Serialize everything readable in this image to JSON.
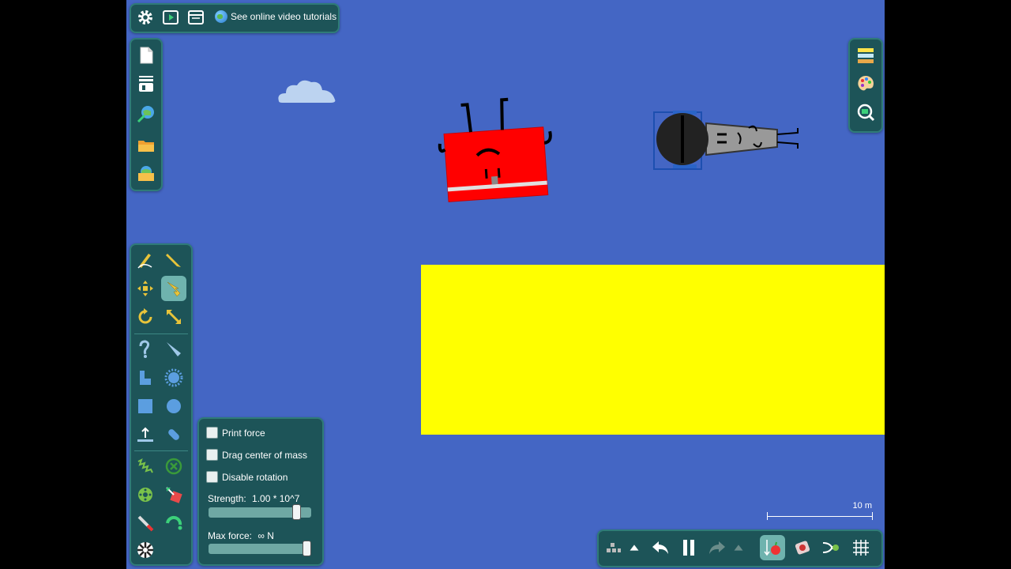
{
  "toolbar_top": {
    "tutorials_label": "See online video tutorials",
    "icons": [
      "gear-icon",
      "play-video-icon",
      "window-icon",
      "globe-icon"
    ]
  },
  "file_panel": {
    "icons": [
      "new-file-icon",
      "scene-settings-icon",
      "open-web-icon",
      "folder-icon",
      "save-icon"
    ]
  },
  "right_panel": {
    "icons": [
      "layers-icon",
      "palette-icon",
      "zoom-fit-icon"
    ]
  },
  "tools": {
    "icons": [
      "sketch-icon",
      "pencil-icon",
      "move-icon",
      "drag-hand-icon",
      "rotate-icon",
      "scale-icon",
      "chain-icon",
      "knife-icon",
      "polygon-icon",
      "gear-shape-icon",
      "box-icon",
      "circle-icon",
      "plane-icon",
      "thruster-icon",
      "spring-icon",
      "fixate-icon",
      "axle-icon",
      "hinge-icon",
      "laser-icon",
      "tracer-icon",
      "spiral-icon"
    ],
    "active": "drag-hand-icon"
  },
  "options": {
    "print_force_label": "Print force",
    "drag_center_label": "Drag center of mass",
    "disable_rotation_label": "Disable rotation",
    "print_force_checked": false,
    "drag_center_checked": false,
    "disable_rotation_checked": false,
    "strength_label": "Strength:",
    "strength_value": "1.00 * 10^7",
    "strength_level": 0.89,
    "maxforce_label": "Max force:",
    "maxforce_value": "∞  N",
    "maxforce_level": 1.0
  },
  "bottom_bar": {
    "icons": [
      "grid-dots-icon",
      "up-arrow-icon",
      "undo-icon",
      "pause-icon",
      "redo-icon",
      "up-arrow-icon",
      "gravity-icon",
      "airfriction-icon",
      "controller-icon",
      "grid-icon"
    ]
  },
  "scale": {
    "label": "10 m"
  },
  "colors": {
    "background": "#4466c4",
    "panel": "#1d5458",
    "accent": "#6fb3ae",
    "ground": "#ffff00"
  }
}
